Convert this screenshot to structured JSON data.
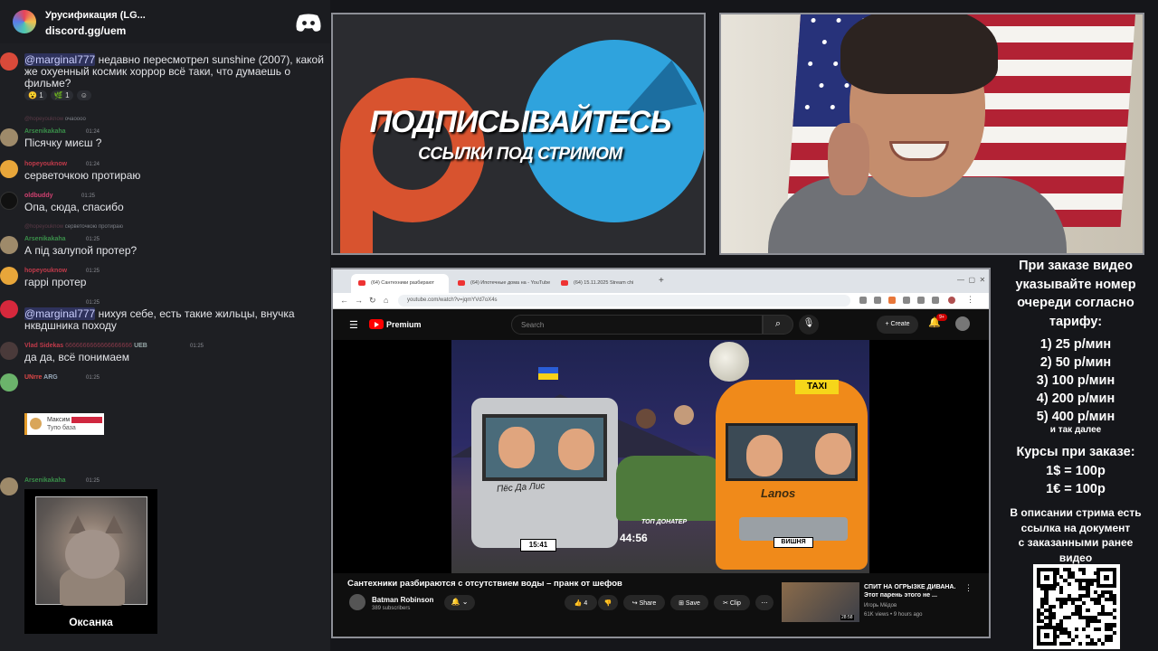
{
  "discord": {
    "server_name": "Урусификация (LG...",
    "invite_link": "discord.gg/uem",
    "messages": [
      {
        "text_mention": "@marginal777",
        "text": " недавно пересмотрел sunshine (2007), какой же охуенный космик хоррор всё таки, что думаешь о фильме?",
        "reactions": [
          "1",
          "1"
        ]
      },
      {
        "reply_user": "@hopeyouknow",
        "reply_text": "очаоооо",
        "user": "Arsenikakaha",
        "time": "01:24",
        "text": "Пісячку миєш ?",
        "color": "#3a8f4a"
      },
      {
        "user": "hopeyouknow",
        "time": "01:24",
        "text": "серветочкою протираю",
        "color": "#c03a4a"
      },
      {
        "user": "oldbuddy",
        "time": "01:25",
        "text": "Опа, сюда, спасибо",
        "color": "#d04070"
      },
      {
        "reply_user": "@hopeyouknow",
        "reply_text": "серветочкою протираю",
        "user": "Arsenikakaha",
        "time": "01:25",
        "text": "А під залупой протер?",
        "color": "#3a8f4a"
      },
      {
        "user": "hopeyouknow",
        "time": "01:25",
        "text": "гаррі протер",
        "color": "#c03a4a"
      },
      {
        "time": "01:25",
        "text_mention": "@marginal777",
        "text": " нихуя себе, есть такие жильцы, внучка нквдшника походу"
      },
      {
        "user": "Vlad Sidekas",
        "user_tail": "6666666666666666666",
        "tag": "UEB",
        "time": "01:25",
        "text": "да да, всё понимаем",
        "color": "#c03a4a"
      },
      {
        "user": "UNrre",
        "tag": "ARG",
        "time": "01:25",
        "color": "#e04848"
      },
      {
        "embed_name": "Максим",
        "embed_text": "Тупо база"
      },
      {
        "user": "Arsenikakaha",
        "time": "01:25",
        "color": "#3a8f4a",
        "image_caption": "Оксанка"
      }
    ]
  },
  "banner": {
    "title": "ПОДПИСЫВАЙТЕСЬ",
    "subtitle": "ССЫЛКИ ПОД СТРИМОМ"
  },
  "browser": {
    "tabs": [
      "(64) Сантехники разбирают",
      "(64) Ипотечные дома на - YouTube",
      "(64) 15.11.2025 Stream chi"
    ],
    "url": "youtube.com/watch?v=jqmYVd7oX4s",
    "youtube": {
      "premium": "Premium",
      "search_placeholder": "Search",
      "create_label": "Create",
      "notif_count": "9+",
      "video": {
        "title": "Сантехники разбираются с отсутствием воды – пранк от шефов",
        "channel": "Batman Robinson",
        "subscribers": "389 subscribers",
        "likes": "4",
        "share": "Share",
        "save": "Save",
        "clip": "Clip",
        "timer": "44:56",
        "plate_left": "15:41",
        "plate_right": "ВИШНЯ",
        "overlay_top": "ТОП ДОНАТЕР",
        "label_truck": "Пёс Да Лис",
        "label_taxi": "TAXI",
        "label_lanos": "Lanos"
      },
      "related": {
        "title": "СПИТ НА ОГРЫЗКЕ ДИВАНА. Этот парень этого не ...",
        "channel": "Игорь Мёдов",
        "meta": "61K views • 9 hours ago",
        "duration": "28:58"
      }
    }
  },
  "info_panel": {
    "intro": [
      "При заказе видео",
      "указывайте номер",
      "очереди согласно",
      "тарифу:"
    ],
    "tariffs": [
      "1) 25 р/мин",
      "2) 50 р/мин",
      "3) 100 р/мин",
      "4) 200 р/мин",
      "5) 400 р/мин"
    ],
    "etc": "и так далее",
    "courses_title": "Курсы при заказе:",
    "courses": [
      "1$ = 100р",
      "1€ = 100р"
    ],
    "description": [
      "В описании стрима есть",
      "ссылка на документ",
      "с заказанными ранее",
      "видео"
    ]
  },
  "colors": {
    "discord_bg": "#1e1f23",
    "mention_bg": "#3c3f8a",
    "youtube_red": "#ff0000",
    "telegram_blue": "#2fa3dd",
    "patreon_orange": "#d8532f"
  }
}
